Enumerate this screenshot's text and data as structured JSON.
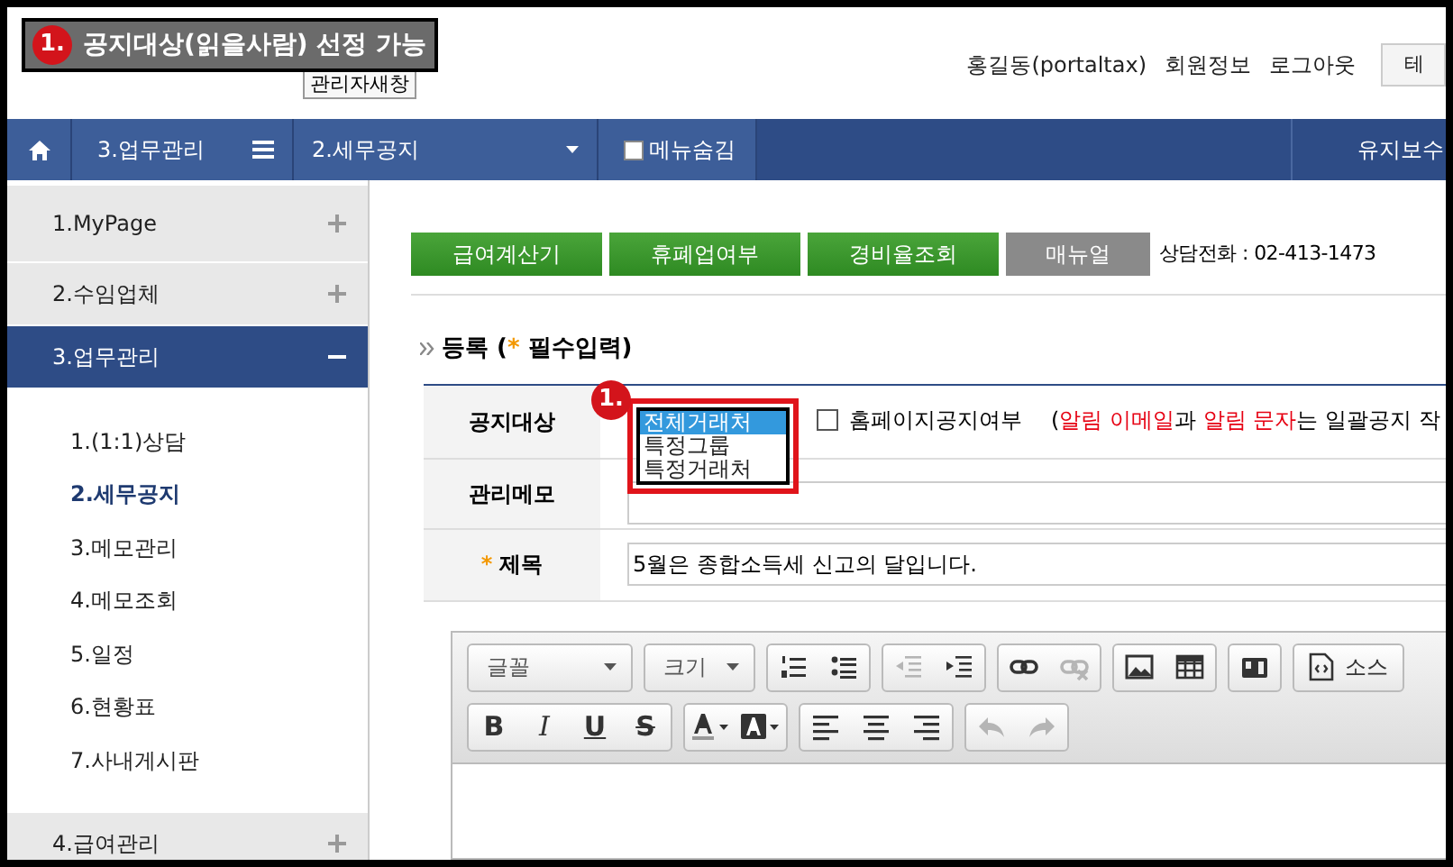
{
  "callout": {
    "number": "1.",
    "text": "공지대상(읽을사람) 선정 가능"
  },
  "header": {
    "admin_button": "관리자새창",
    "user": "홍길동(portaltax)",
    "links": [
      "회원정보",
      "로그아웃"
    ],
    "cut_button": "테"
  },
  "nav": {
    "menu": "3.업무관리",
    "submenu": "2.세무공지",
    "hide_menu": {
      "label": "메뉴숨김",
      "checked": false
    },
    "right": "유지보수"
  },
  "sidebar": {
    "items": [
      {
        "label": "1.MyPage",
        "expanded": false,
        "selected": false
      },
      {
        "label": "2.수임업체",
        "expanded": false,
        "selected": false
      },
      {
        "label": "3.업무관리",
        "expanded": true,
        "selected": true,
        "children": [
          {
            "label": "1.(1:1)상담",
            "selected": false
          },
          {
            "label": "2.세무공지",
            "selected": true
          },
          {
            "label": "3.메모관리",
            "selected": false
          },
          {
            "label": "4.메모조회",
            "selected": false
          },
          {
            "label": "5.일정",
            "selected": false
          },
          {
            "label": "6.현황표",
            "selected": false
          },
          {
            "label": "7.사내게시판",
            "selected": false
          }
        ]
      },
      {
        "label": "4.급여관리",
        "expanded": false,
        "selected": false
      }
    ]
  },
  "quick_buttons": [
    {
      "label": "급여계산기",
      "kind": "green"
    },
    {
      "label": "휴폐업여부",
      "kind": "green"
    },
    {
      "label": "경비율조회",
      "kind": "green"
    },
    {
      "label": "매뉴얼",
      "kind": "gray"
    }
  ],
  "phone": "상담전화 : 02-413-1473",
  "section": {
    "title": "등록 (",
    "required_mark": "*",
    "title_end": " 필수입력)"
  },
  "form": {
    "target": {
      "label": "공지대상",
      "options": [
        {
          "label": "전체거래처",
          "selected": true
        },
        {
          "label": "특정그룹",
          "selected": false
        },
        {
          "label": "특정거래처",
          "selected": false
        }
      ],
      "callout": "1.",
      "homepage": {
        "label": "홈페이지공지여부",
        "checked": false
      },
      "note": [
        {
          "text": "(",
          "red": false
        },
        {
          "text": "알림 이메일",
          "red": true
        },
        {
          "text": "과 ",
          "red": false
        },
        {
          "text": "알림 문자",
          "red": true
        },
        {
          "text": "는 일괄공지 작",
          "red": false
        }
      ]
    },
    "memo": {
      "label": "관리메모"
    },
    "subject": {
      "required": "*",
      "label": "제목",
      "value": "5월은 종합소득세 신고의 달입니다."
    }
  },
  "editor": {
    "rows": [
      [
        [
          {
            "kind": "select",
            "label": "글꼴",
            "disabled": false
          }
        ],
        [
          {
            "kind": "select",
            "label": "크기",
            "disabled": false
          }
        ],
        [
          {
            "kind": "ol",
            "disabled": false
          },
          {
            "kind": "ul",
            "disabled": false
          }
        ],
        [
          {
            "kind": "outdent",
            "disabled": true
          },
          {
            "kind": "indent",
            "disabled": false
          }
        ],
        [
          {
            "kind": "link",
            "disabled": false
          },
          {
            "kind": "unlink",
            "disabled": true
          }
        ],
        [
          {
            "kind": "image",
            "disabled": false
          },
          {
            "kind": "table",
            "disabled": false
          }
        ],
        [
          {
            "kind": "media",
            "disabled": false
          }
        ],
        [
          {
            "kind": "source",
            "label": "소스",
            "disabled": false
          }
        ]
      ],
      [
        [
          {
            "kind": "bold",
            "label": "B",
            "disabled": false
          },
          {
            "kind": "italic",
            "label": "I",
            "disabled": false
          },
          {
            "kind": "underline",
            "label": "U",
            "disabled": false
          },
          {
            "kind": "strike",
            "label": "S",
            "disabled": false
          }
        ],
        [
          {
            "kind": "textcolor",
            "disabled": false
          },
          {
            "kind": "bgcolor",
            "disabled": false
          }
        ],
        [
          {
            "kind": "left",
            "disabled": false
          },
          {
            "kind": "center",
            "disabled": false
          },
          {
            "kind": "right",
            "disabled": false
          }
        ],
        [
          {
            "kind": "undo",
            "disabled": true
          },
          {
            "kind": "redo",
            "disabled": true
          }
        ]
      ]
    ]
  }
}
